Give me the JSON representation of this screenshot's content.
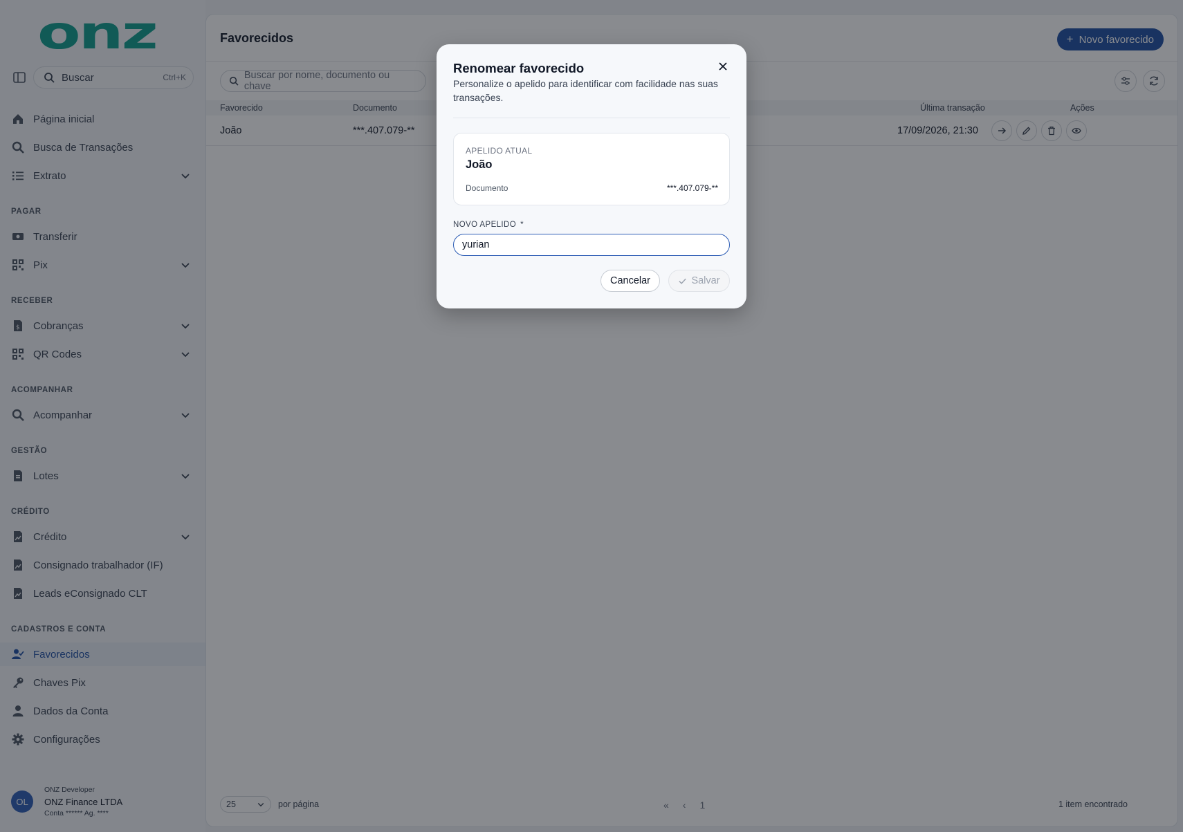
{
  "brand": {
    "logo_text": "onz"
  },
  "sidebar": {
    "search": {
      "label": "Buscar",
      "shortcut": "Ctrl+K"
    },
    "items": [
      {
        "label": "Página inicial"
      },
      {
        "label": "Busca de Transações"
      },
      {
        "label": "Extrato"
      },
      {
        "label": "Transferir"
      },
      {
        "label": "Pix"
      },
      {
        "label": "Cobranças"
      },
      {
        "label": "QR Codes"
      },
      {
        "label": "Acompanhar"
      },
      {
        "label": "Lotes"
      },
      {
        "label": "Crédito"
      },
      {
        "label": "Consignado trabalhador (IF)"
      },
      {
        "label": "Leads eConsignado CLT"
      },
      {
        "label": "Favorecidos"
      },
      {
        "label": "Chaves Pix"
      },
      {
        "label": "Dados da Conta"
      },
      {
        "label": "Configurações"
      }
    ],
    "sections": {
      "pagar": "PAGAR",
      "receber": "RECEBER",
      "acompanhar": "ACOMPANHAR",
      "gestao": "GESTÃO",
      "credito": "CRÉDITO",
      "cadastros": "CADASTROS E CONTA"
    },
    "active_item": "Favorecidos",
    "user": {
      "initials": "OL",
      "role": "ONZ Developer",
      "company": "ONZ Finance LTDA",
      "account": "Conta ****** Ag. ****"
    }
  },
  "main": {
    "title": "Favorecidos",
    "new_button": "Novo favorecido",
    "search_placeholder": "Buscar por nome, documento ou chave",
    "columns": {
      "favorecido": "Favorecido",
      "documento": "Documento",
      "ultima": "Última transação",
      "acoes": "Ações"
    },
    "rows": [
      {
        "favorecido": "João",
        "documento": "***.407.079-**",
        "ultima": "17/09/2026, 21:30"
      }
    ],
    "footer": {
      "per_page_value": "25",
      "per_page_label": "por página",
      "page": "1",
      "count": "1 item encontrado"
    }
  },
  "modal": {
    "title": "Renomear favorecido",
    "description": "Personalize o apelido para identificar com facilidade nas suas transações.",
    "current_label": "APELIDO ATUAL",
    "current_value": "João",
    "doc_label": "Documento",
    "doc_value": "***.407.079-**",
    "field_label": "NOVO APELIDO",
    "required_mark": "*",
    "field_value": "yurian",
    "cancel": "Cancelar",
    "save": "Salvar"
  },
  "colors": {
    "brand_teal": "#0f9d8c",
    "primary": "#1e4fa3"
  }
}
